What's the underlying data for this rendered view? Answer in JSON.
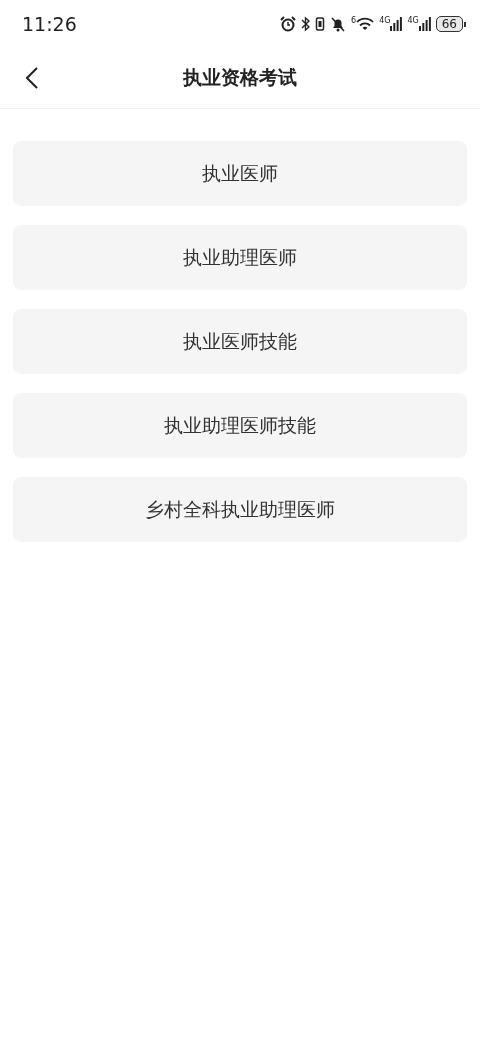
{
  "status_bar": {
    "time": "11:26",
    "wifi_badge": "6",
    "signal_labels": [
      "4G",
      "4G"
    ],
    "battery": "66"
  },
  "header": {
    "title": "执业资格考试"
  },
  "options": [
    {
      "label": "执业医师"
    },
    {
      "label": "执业助理医师"
    },
    {
      "label": "执业医师技能"
    },
    {
      "label": "执业助理医师技能"
    },
    {
      "label": "乡村全科执业助理医师"
    }
  ]
}
